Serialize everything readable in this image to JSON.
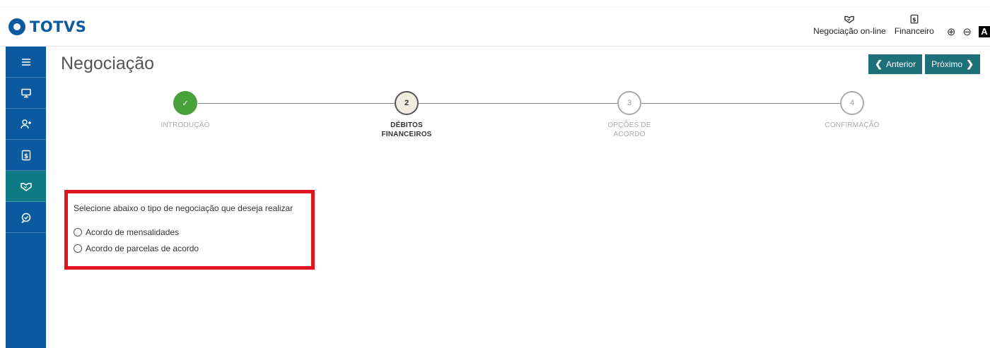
{
  "brand": {
    "name": "TOTVS",
    "color": "#0b5aa0"
  },
  "header": {
    "links": [
      {
        "label": "Negociação on-line",
        "icon": "handshake-icon"
      },
      {
        "label": "Financeiro",
        "icon": "money-doc-icon"
      }
    ],
    "zoom_in": "⊕",
    "zoom_out": "⊖",
    "contrast": "A"
  },
  "sidebar": {
    "items": [
      {
        "icon": "menu-icon",
        "active": false
      },
      {
        "icon": "monitor-icon",
        "active": false
      },
      {
        "icon": "add-user-icon",
        "active": false
      },
      {
        "icon": "money-doc-icon",
        "active": false
      },
      {
        "icon": "handshake-icon",
        "active": true
      },
      {
        "icon": "chat-check-icon",
        "active": false
      }
    ],
    "active_color": "#0d7a84"
  },
  "page": {
    "title": "Negociação",
    "prev_label": "Anterior",
    "next_label": "Próximo"
  },
  "stepper": {
    "steps": [
      {
        "number": "✓",
        "label_1": "INTRODUÇÃO",
        "label_2": "",
        "state": "done"
      },
      {
        "number": "2",
        "label_1": "DÉBITOS",
        "label_2": "FINANCEIROS",
        "state": "current"
      },
      {
        "number": "3",
        "label_1": "OPÇÕES DE",
        "label_2": "ACORDO",
        "state": "pending"
      },
      {
        "number": "4",
        "label_1": "CONFIRMAÇÃO",
        "label_2": "",
        "state": "pending"
      }
    ]
  },
  "selection": {
    "prompt": "Selecione abaixo o tipo de negociação que deseja realizar",
    "options": [
      {
        "label": "Acordo de mensalidades",
        "selected": false
      },
      {
        "label": "Acordo de parcelas de acordo",
        "selected": false
      }
    ],
    "highlight_color": "#e0141e"
  }
}
